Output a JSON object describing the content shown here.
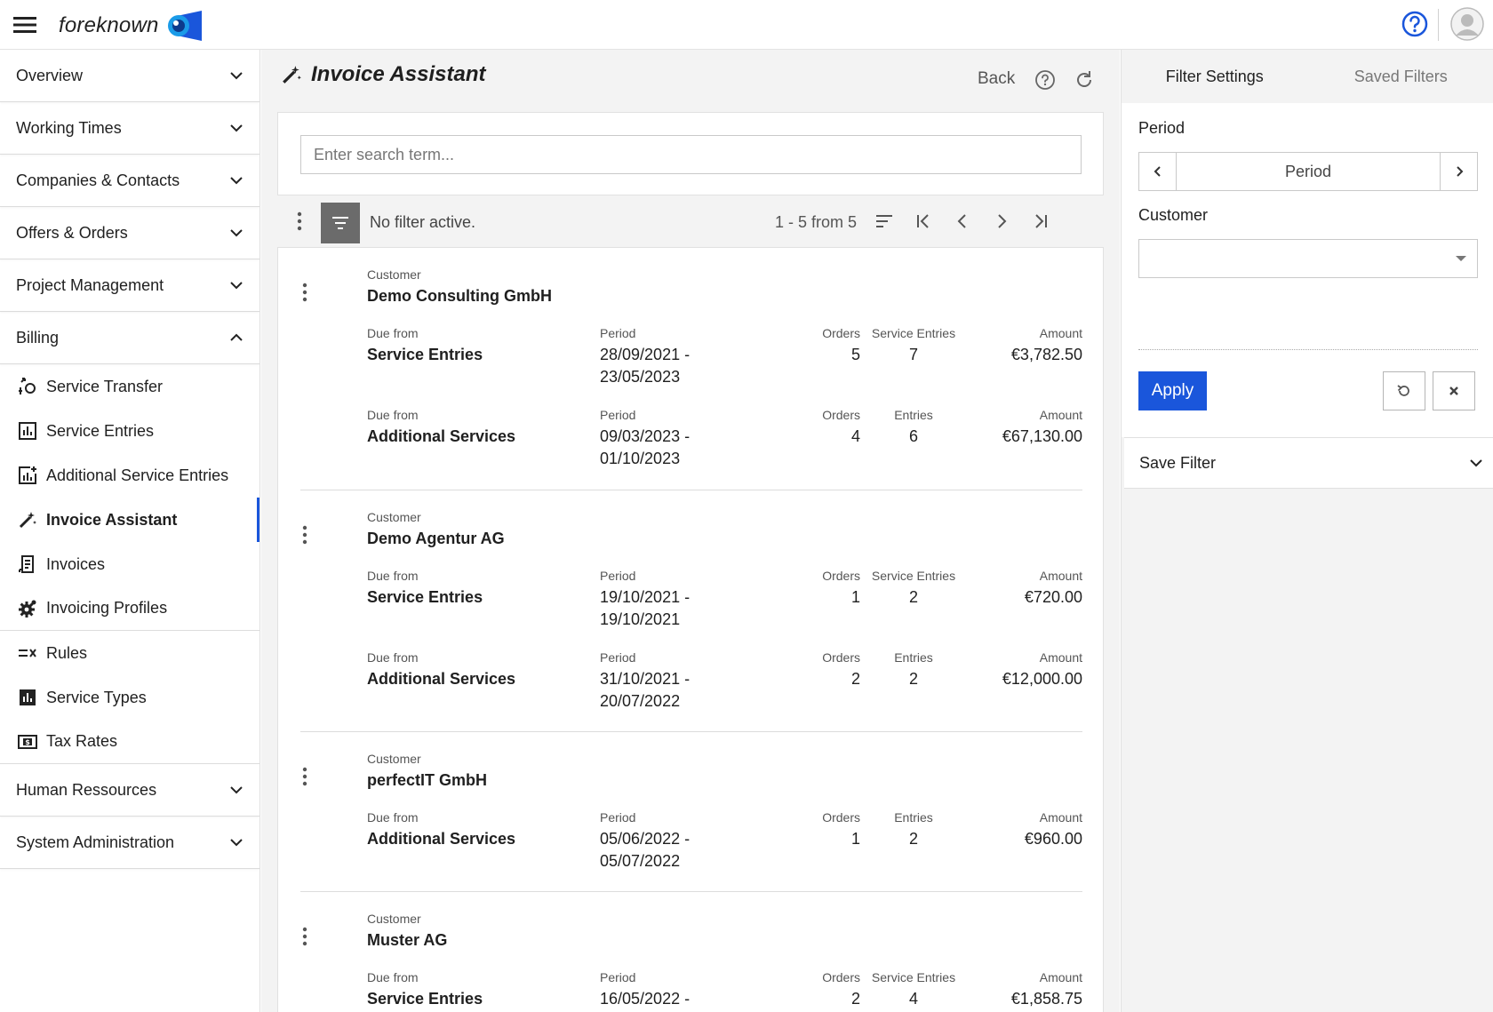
{
  "app": {
    "logo_text": "foreknown",
    "brand_color": "#1a56db"
  },
  "sidebar": {
    "sections_top": [
      {
        "label": "Overview"
      },
      {
        "label": "Working Times"
      },
      {
        "label": "Companies & Contacts"
      },
      {
        "label": "Offers & Orders"
      },
      {
        "label": "Project Management"
      }
    ],
    "billing": {
      "label": "Billing",
      "items": [
        {
          "label": "Service Transfer",
          "icon": "service-transfer-icon"
        },
        {
          "label": "Service Entries",
          "icon": "bar-chart-icon"
        },
        {
          "label": "Additional Service Entries",
          "icon": "chart-plus-icon"
        },
        {
          "label": "Invoice Assistant",
          "icon": "magic-wand-icon",
          "active": true
        },
        {
          "label": "Invoices",
          "icon": "invoice-icon"
        },
        {
          "label": "Invoicing Profiles",
          "icon": "gear-icon"
        }
      ],
      "items2": [
        {
          "label": "Rules",
          "icon": "rules-icon"
        },
        {
          "label": "Service Types",
          "icon": "bar-chart-filled-icon"
        },
        {
          "label": "Tax Rates",
          "icon": "dollar-box-icon"
        }
      ]
    },
    "sections_bottom": [
      {
        "label": "Human Ressources"
      },
      {
        "label": "System Administration"
      }
    ]
  },
  "main": {
    "title": "Invoice Assistant",
    "back_label": "Back",
    "search_placeholder": "Enter search term...",
    "no_filter": "No filter active.",
    "pager_info": "1 - 5 from 5",
    "labels": {
      "customer": "Customer",
      "due_from": "Due from",
      "period": "Period",
      "orders": "Orders",
      "service_entries": "Service Entries",
      "entries": "Entries",
      "amount": "Amount"
    },
    "entries": [
      {
        "customer": "Demo Consulting GmbH",
        "rows": [
          {
            "due_from": "Service Entries",
            "period_start": "28/09/2021 -",
            "period_end": "23/05/2023",
            "orders": "5",
            "entries_label": "Service Entries",
            "entries": "7",
            "amount": "€3,782.50"
          },
          {
            "due_from": "Additional Services",
            "period_start": "09/03/2023 -",
            "period_end": "01/10/2023",
            "orders": "4",
            "entries_label": "Entries",
            "entries": "6",
            "amount": "€67,130.00"
          }
        ]
      },
      {
        "customer": "Demo Agentur AG",
        "rows": [
          {
            "due_from": "Service Entries",
            "period_start": "19/10/2021 -",
            "period_end": "19/10/2021",
            "orders": "1",
            "entries_label": "Service Entries",
            "entries": "2",
            "amount": "€720.00"
          },
          {
            "due_from": "Additional Services",
            "period_start": "31/10/2021 -",
            "period_end": "20/07/2022",
            "orders": "2",
            "entries_label": "Entries",
            "entries": "2",
            "amount": "€12,000.00"
          }
        ]
      },
      {
        "customer": "perfectIT GmbH",
        "rows": [
          {
            "due_from": "Additional Services",
            "period_start": "05/06/2022 -",
            "period_end": "05/07/2022",
            "orders": "1",
            "entries_label": "Entries",
            "entries": "2",
            "amount": "€960.00"
          }
        ]
      },
      {
        "customer": "Muster AG",
        "rows": [
          {
            "due_from": "Service Entries",
            "period_start": "16/05/2022 -",
            "period_end": "",
            "orders": "2",
            "entries_label": "Service Entries",
            "entries": "4",
            "amount": "€1,858.75"
          }
        ]
      }
    ]
  },
  "filter_panel": {
    "tabs": [
      {
        "label": "Filter Settings",
        "active": true
      },
      {
        "label": "Saved Filters",
        "active": false
      }
    ],
    "period_label": "Period",
    "period_value": "Period",
    "customer_label": "Customer",
    "customer_value": "",
    "apply_label": "Apply",
    "save_filter_label": "Save Filter"
  }
}
